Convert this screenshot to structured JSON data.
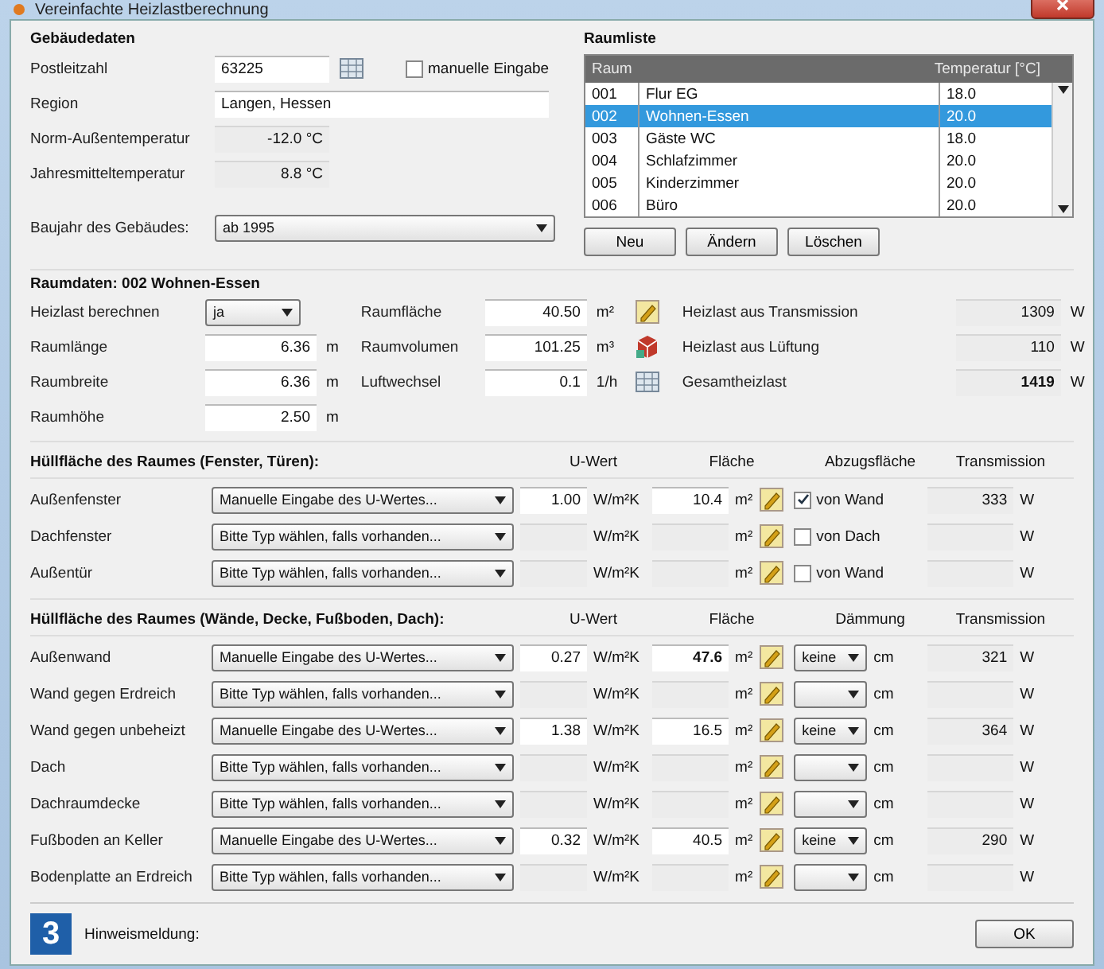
{
  "window": {
    "title": "Vereinfachte Heizlastberechnung"
  },
  "building": {
    "title": "Gebäudedaten",
    "postcode": {
      "label": "Postleitzahl",
      "value": "63225"
    },
    "manual": {
      "label": "manuelle Eingabe",
      "checked": false
    },
    "region": {
      "label": "Region",
      "value": "Langen, Hessen"
    },
    "norm_temp": {
      "label": "Norm-Außentemperatur",
      "value": "-12.0 °C"
    },
    "annual_temp": {
      "label": "Jahresmitteltemperatur",
      "value": "8.8 °C"
    },
    "year": {
      "label": "Baujahr des Gebäudes:",
      "value": "ab 1995"
    }
  },
  "rooms": {
    "title": "Raumliste",
    "columns": [
      "Raum",
      "Temperatur [°C]"
    ],
    "rows": [
      {
        "no": "001",
        "name": "Flur EG",
        "temp": "18.0",
        "selected": false
      },
      {
        "no": "002",
        "name": "Wohnen-Essen",
        "temp": "20.0",
        "selected": true
      },
      {
        "no": "003",
        "name": "Gäste WC",
        "temp": "18.0",
        "selected": false
      },
      {
        "no": "004",
        "name": "Schlafzimmer",
        "temp": "20.0",
        "selected": false
      },
      {
        "no": "005",
        "name": "Kinderzimmer",
        "temp": "20.0",
        "selected": false
      },
      {
        "no": "006",
        "name": "Büro",
        "temp": "20.0",
        "selected": false
      }
    ],
    "buttons": [
      "Neu",
      "Ändern",
      "Löschen"
    ]
  },
  "room_data": {
    "title": "Raumdaten: 002 Wohnen-Essen",
    "calc": {
      "label": "Heizlast berechnen",
      "value": "ja"
    },
    "dims": [
      {
        "label": "Raumlänge",
        "value": "6.36",
        "unit": "m"
      },
      {
        "label": "Raumbreite",
        "value": "6.36",
        "unit": "m"
      },
      {
        "label": "Raumhöhe",
        "value": "2.50",
        "unit": "m"
      }
    ],
    "derived": [
      {
        "label": "Raumfläche",
        "value": "40.50",
        "unit": "m²",
        "kind": "pencil"
      },
      {
        "label": "Raumvolumen",
        "value": "101.25",
        "unit": "m³",
        "kind": "cube"
      },
      {
        "label": "Luftwechsel",
        "value": "0.1",
        "unit": "1/h",
        "kind": "table"
      }
    ],
    "results": [
      {
        "label": "Heizlast aus Transmission",
        "value": "1309",
        "unit": "W",
        "bold": false
      },
      {
        "label": "Heizlast aus Lüftung",
        "value": "110",
        "unit": "W",
        "bold": false
      },
      {
        "label": "Gesamtheizlast",
        "value": "1419",
        "unit": "W",
        "bold": true
      }
    ]
  },
  "openings": {
    "title": "Hüllfläche des Raumes (Fenster, Türen):",
    "columns": [
      "U-Wert",
      "Fläche",
      "Abzugsfläche",
      "Transmission"
    ],
    "rows": [
      {
        "label": "Außenfenster",
        "type": "Manuelle Eingabe des U-Wertes...",
        "u_value": "1.00",
        "u_unit": "W/m²K",
        "area": "10.4",
        "area_unit": "m²",
        "deduct": {
          "label": "von Wand",
          "checked": true
        },
        "transmission": "333",
        "t_unit": "W"
      },
      {
        "label": "Dachfenster",
        "type": "Bitte Typ wählen, falls vorhanden...",
        "u_unit": "W/m²K",
        "area_unit": "m²",
        "deduct": {
          "label": "von Dach",
          "checked": false
        },
        "t_unit": "W"
      },
      {
        "label": "Außentür",
        "type": "Bitte Typ wählen, falls vorhanden...",
        "u_unit": "W/m²K",
        "area_unit": "m²",
        "deduct": {
          "label": "von Wand",
          "checked": false
        },
        "t_unit": "W"
      }
    ]
  },
  "surfaces": {
    "title": "Hüllfläche des Raumes (Wände, Decke, Fußboden, Dach):",
    "columns": [
      "U-Wert",
      "Fläche",
      "Dämmung",
      "Transmission"
    ],
    "rows": [
      {
        "label": "Außenwand",
        "type": "Manuelle Eingabe des U-Wertes...",
        "u_value": "0.27",
        "u_unit": "W/m²K",
        "area": "47.6",
        "area_bold": true,
        "area_unit": "m²",
        "insulation": "keine",
        "i_unit": "cm",
        "transmission": "321",
        "t_unit": "W"
      },
      {
        "label": "Wand gegen Erdreich",
        "type": "Bitte Typ wählen, falls vorhanden...",
        "u_unit": "W/m²K",
        "area_unit": "m²",
        "i_unit": "cm",
        "t_unit": "W"
      },
      {
        "label": "Wand gegen unbeheizt",
        "type": "Manuelle Eingabe des U-Wertes...",
        "u_value": "1.38",
        "u_unit": "W/m²K",
        "area": "16.5",
        "area_unit": "m²",
        "insulation": "keine",
        "i_unit": "cm",
        "transmission": "364",
        "t_unit": "W"
      },
      {
        "label": "Dach",
        "type": "Bitte Typ wählen, falls vorhanden...",
        "u_unit": "W/m²K",
        "area_unit": "m²",
        "i_unit": "cm",
        "t_unit": "W"
      },
      {
        "label": "Dachraumdecke",
        "type": "Bitte Typ wählen, falls vorhanden...",
        "u_unit": "W/m²K",
        "area_unit": "m²",
        "i_unit": "cm",
        "t_unit": "W"
      },
      {
        "label": "Fußboden an Keller",
        "type": "Manuelle Eingabe des U-Wertes...",
        "u_value": "0.32",
        "u_unit": "W/m²K",
        "area": "40.5",
        "area_unit": "m²",
        "insulation": "keine",
        "i_unit": "cm",
        "transmission": "290",
        "t_unit": "W"
      },
      {
        "label": "Bodenplatte an Erdreich",
        "type": "Bitte Typ wählen, falls vorhanden...",
        "u_unit": "W/m²K",
        "area_unit": "m²",
        "i_unit": "cm",
        "t_unit": "W"
      }
    ]
  },
  "footer": {
    "figure_number": "3",
    "status_label": "Hinweismeldung:",
    "ok": "OK"
  }
}
